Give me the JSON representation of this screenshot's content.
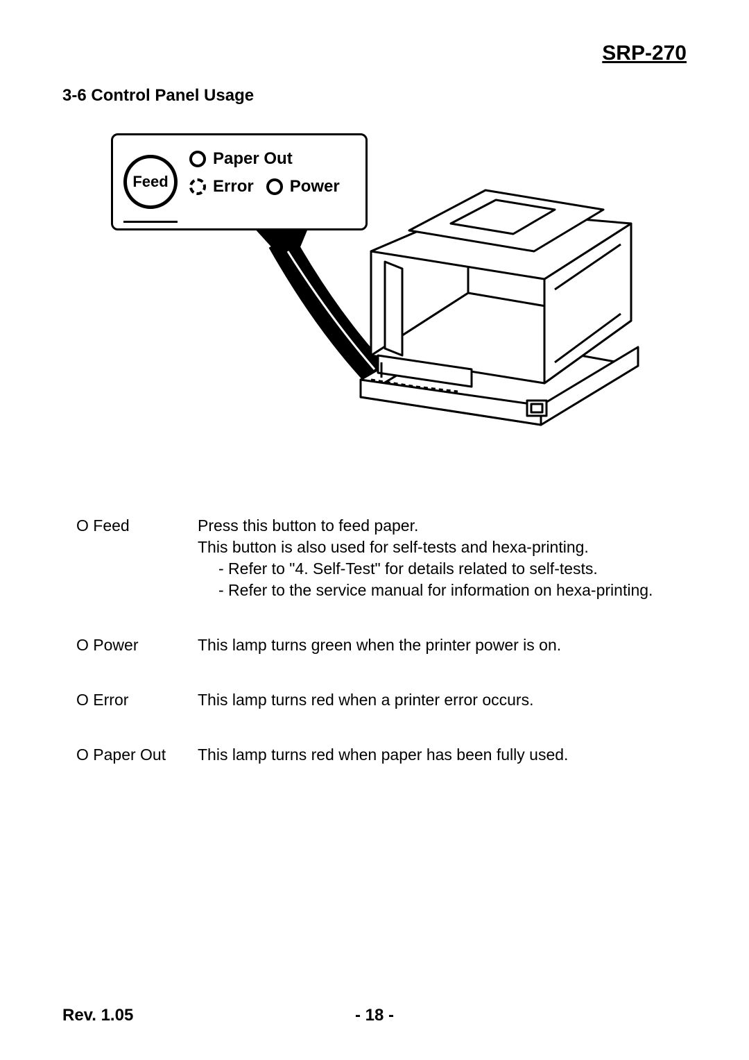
{
  "header": {
    "model": "SRP-270"
  },
  "section": {
    "title": "3-6 Control Panel Usage"
  },
  "panel": {
    "feed_button": "Feed",
    "paper_out": "Paper Out",
    "error": "Error",
    "power": "Power"
  },
  "descriptions": {
    "feed": {
      "label": "O Feed",
      "line1": "Press this button to feed paper.",
      "line2": "This button is also used for self-tests and hexa-printing.",
      "line3": "- Refer to \"4. Self-Test\" for details related to self-tests.",
      "line4": "- Refer to the service manual for information on hexa-printing."
    },
    "power": {
      "label": "O Power",
      "line1": "This lamp turns green when the printer power is on."
    },
    "error": {
      "label": "O Error",
      "line1": "This lamp turns red when a printer error occurs."
    },
    "paper_out": {
      "label": "O Paper Out",
      "line1": "This lamp turns red when paper has been fully used."
    }
  },
  "footer": {
    "revision": "Rev. 1.05",
    "page": "- 18 -"
  }
}
